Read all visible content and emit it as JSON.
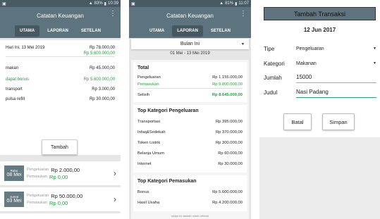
{
  "status": {
    "p1": {
      "battery": "83%",
      "time": "10:39"
    },
    "p2": {
      "battery": "81%",
      "time": "11:07"
    }
  },
  "app": {
    "title": "Catatan Keuangan"
  },
  "tabs": [
    "UTAMA",
    "LAPORAN",
    "SETELAN"
  ],
  "home": {
    "date_label": "Hari Ini, 13 Mei 2019",
    "total_out": "Rp 78.000,00",
    "total_in": "Rp 5.600.000,00",
    "items": [
      {
        "name": "makan",
        "amount": "Rp 45.000,00",
        "type": "out"
      },
      {
        "name": "dapat bonus",
        "amount": "Rp 5.600.000,00",
        "type": "in"
      },
      {
        "name": "transport",
        "amount": "Rp 3.000,00",
        "type": "out"
      },
      {
        "name": "pulsa refill",
        "amount": "Rp 30.000,00",
        "type": "out"
      }
    ],
    "add_button": "Tambah",
    "days": [
      {
        "weekday": "Rabu",
        "date": "08 Mei",
        "out_label": "Pengeluaran",
        "out": "Rp 2.000,00",
        "in_label": "Pemasukan",
        "in": "Rp 0,00"
      },
      {
        "weekday": "Jumat",
        "date": "03 Mei",
        "out_label": "Pengeluaran",
        "out": "Rp 50.000,00",
        "in_label": "Pemasukan",
        "in": "Rp 0,00"
      }
    ]
  },
  "report": {
    "period_select": "Bulan Ini",
    "range": "01 Mei - 13 Mei 2019",
    "total": {
      "title": "Total",
      "rows": [
        {
          "label": "Pengeluaran",
          "amount": "Rp 1.155.000,00",
          "type": "out"
        },
        {
          "label": "Pemasukan",
          "amount": "Rp 9.800.000,00",
          "type": "in"
        }
      ],
      "diff_label": "Selisih",
      "diff": "Rp 8.645.000,00"
    },
    "top_out": {
      "title": "Top Kategori Pengeluaran",
      "rows": [
        {
          "label": "Transportasi",
          "amount": "Rp 395.000,00"
        },
        {
          "label": "Infaq&Sedekah",
          "amount": "Rp 370.000,00"
        },
        {
          "label": "Token Listrik",
          "amount": "Rp 300.000,00"
        },
        {
          "label": "Belanja Umum",
          "amount": "Rp 60.000,00"
        },
        {
          "label": "Internet",
          "amount": "Rp 30.000,00"
        }
      ]
    },
    "top_in": {
      "title": "Top Kategori Pemasukan",
      "rows": [
        {
          "label": "Bonus",
          "amount": "Rp 5.600.000,00"
        },
        {
          "label": "Hasil Usaha",
          "amount": "Rp 4.200.000,00"
        }
      ]
    },
    "swipe_hint": "swipe ke bawah untuk refresh"
  },
  "dialog": {
    "title": "Tambah Transaksi",
    "date": "12 Jun 2017",
    "fields": {
      "tipe_label": "Tipe",
      "tipe_value": "Pengeluaran",
      "kategori_label": "Kategori",
      "kategori_value": "Makanan",
      "jumlah_label": "Jumlah",
      "jumlah_value": "15000",
      "judul_label": "Judul",
      "judul_value": "Nasi Padang"
    },
    "cancel": "Batal",
    "save": "Simpan"
  },
  "colors": {
    "toolbar": "#5d737e",
    "status_bar": "#485a63",
    "income": "#1e9e3e",
    "accent": "#2a9d8f"
  }
}
